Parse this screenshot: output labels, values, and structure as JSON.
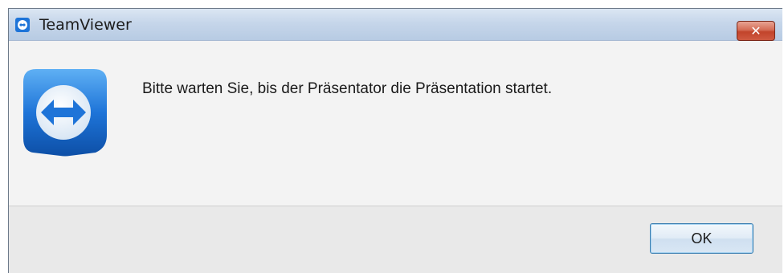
{
  "window": {
    "title": "TeamViewer"
  },
  "dialog": {
    "message": "Bitte warten Sie, bis der Präsentator die Präsentation startet.",
    "ok_label": "OK"
  },
  "controls": {
    "close_label": "✕"
  },
  "icons": {
    "app": "teamviewer-icon",
    "logo": "teamviewer-logo-icon",
    "close": "close-icon"
  },
  "colors": {
    "titlebar": "#c6d6ea",
    "close_button": "#c8462d",
    "logo_blue": "#1e74d8",
    "ok_border": "#3c7fb1"
  }
}
